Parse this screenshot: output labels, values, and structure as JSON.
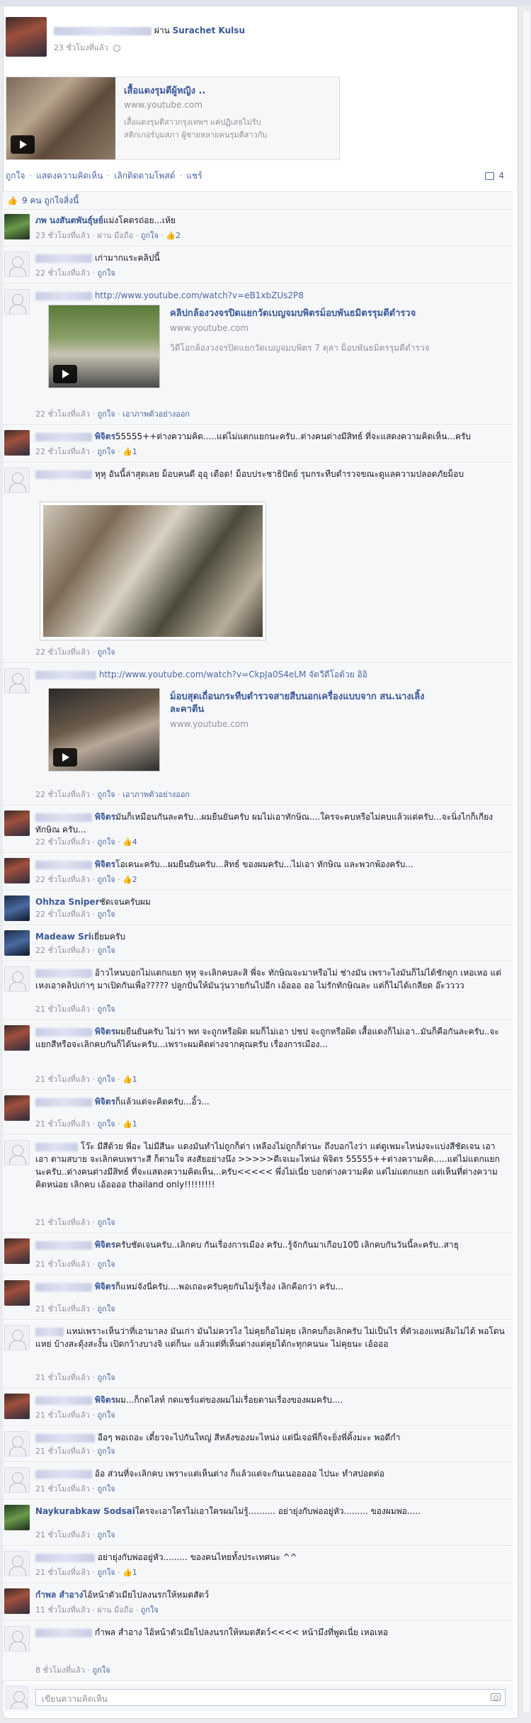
{
  "post": {
    "via": "ผ่าน",
    "via_name": "Surachet Kulsu",
    "time": "23 ชั่วโมงที่แล้ว",
    "share_title": "เสื้อแดงรุมตีผู้หญิง ..",
    "share_site": "www.youtube.com",
    "share_desc_1": "เสื้อแดงรุมตีสาวกรุงเทพฯ แค่ปฏิเสธไม่รับ",
    "share_desc_2": "สติกเกอร์บุมสภา ผู้ชายหลายคนรุมตีสาวกับ"
  },
  "actions": {
    "like": "ถูกใจ",
    "comment": "แสดงความคิดเห็น",
    "unfollow": "เลิกติดตามโพสต์",
    "share": "แชร์",
    "comment_count": "4"
  },
  "likes_summary": "9 คน ถูกใจสิ่งนี้",
  "common": {
    "like": "ถูกใจ",
    "remove_preview": "เอาภาพตัวอย่างออก",
    "dot": " · "
  },
  "comments": [
    {
      "name": "ภพ นงสันตพันธุ์ษย์",
      "text": "แม่งโคตรถ่อย...เห้ย",
      "time": "23 ชั่วโมงที่แล้ว",
      "extra": "ผ่าน มือถือ",
      "likes": "2"
    },
    {
      "name": "",
      "text": "เก่ามากแระคลิปนี้",
      "time": "22 ชั่วโมงที่แล้ว",
      "extra": "",
      "likes": ""
    },
    {
      "name": "",
      "text": "http://www.youtube.com/watch?v=eB1xbZUs2P8",
      "time": "22 ชั่วโมงที่แล้ว",
      "extra": "",
      "likes": "",
      "embed_title": "คลิปกล้องวงจรปิดแยกวัดเบญจมบพิตรม็อบพันธมิตรรุมตีตำรวจ",
      "embed_site": "www.youtube.com",
      "embed_desc": "วิดีโอกล้องวงจรปิดแยกวัดเบญจมบพิตร 7 ตุลา ม็อบพันธมิตรรุมตีตำรวจ"
    },
    {
      "name": "พิจิตร",
      "text": "55555++ต่างความคิด.....แต่ไม่แตกแยกนะครับ..ต่างคนต่างมีสิทธ์ ที่จะแสดงความคิดเห็น...ครับ",
      "time": "22 ชั่วโมงที่แล้ว",
      "extra": "",
      "likes": "1"
    },
    {
      "name": "",
      "text": "หุหุ อันนี้ล่าสุดเลย ม็อบคนดี อุอุ เดือด! ม็อบประชาธิปัตย์ รุมกระทืบตำรวจขณะดูแลความปลอดภัยม็อบ",
      "time": "22 ชั่วโมงที่แล้ว",
      "extra": "",
      "likes": ""
    },
    {
      "name": "",
      "text": "http://www.youtube.com/watch?v=CkpJa0S4eLM จัดวีดีโอด้วย อิอิ",
      "time": "22 ชั่วโมงที่แล้ว",
      "extra": "",
      "likes": "",
      "embed_title": "ม็อบสุดเถื่อนกระทืบตำรวจสายสืบนอกเครื่องแบบจาก สน.นางเลิ้ง",
      "embed_title_2": "ละคาตีน",
      "embed_site": "www.youtube.com"
    },
    {
      "name": "พิจิตร",
      "text": "มันก็เหมือนกันละครับ...ผมยืนยันครับ ผมไม่เอาทักษิณ....ใครจะคบหรือไม่คบแล้วแต่ครับ...จะนิ่งไกก็เกียงทักษิณ ครับ...",
      "time": "22 ชั่วโมงที่แล้ว",
      "extra": "",
      "likes": "4"
    },
    {
      "name": "พิจิตร",
      "text": "โอเคนะครับ...ผมยืนยันครับ...สิทธ์ ของผมครับ...ไม่เอา ทักษิณ และพวกพ้องครับ...",
      "time": "22 ชั่วโมงที่แล้ว",
      "extra": "",
      "likes": "2"
    },
    {
      "name": "Ohhza Sniper",
      "text": "ชัดเจนครับผม",
      "time": "22 ชั่วโมงที่แล้ว",
      "extra": "",
      "likes": ""
    },
    {
      "name": "Madeaw Sri",
      "text": "เยี่ยมครับ",
      "time": "22 ชั่วโมงที่แล้ว",
      "extra": "",
      "likes": ""
    },
    {
      "name": "",
      "text": "อ้าวไหนบอกไม่แตกแยก หุหุ จะเลิกคบละสิ พี่จะ ทักษิณจะมาหรือไม่ ช่างมัน เพราะไงมันก็ไม่ได้ชักดูก เหอเหอ แต่เหงเอาคลิปเก่าๆ มาเปิดกันเพื่อ????? ปลูกปั่นให้มันวุ่นวายกันไปอีก เอ้อออ ออ ไม่รักทักษิณละ แต่ก็ไม่ได้เกลียด อ๊ะวววว",
      "time": "21 ชั่วโมงที่แล้ว",
      "extra": "",
      "likes": ""
    },
    {
      "name": "พิจิตร",
      "text": "ผมยืนยันครับ ไม่ว่า พท จะถูกหรือผิด ผมก็ไม่เอา ปชป จะถูกหรือผิด เสื้อแดงก็ไม่เอา..มันก็คือกันละครับ..จะแยกสีหรือจะเลิกคบกันก็ได้นะครับ...เพราะผมคิดต่างจากคุณครับ เรื่องการเมือง...",
      "time": "21 ชั่วโมงที่แล้ว",
      "extra": "",
      "likes": "1"
    },
    {
      "name": "พิจิตร",
      "text": "ก็แล้วแต่จะคิดครับ...อิ้ว...",
      "time": "21 ชั่วโมงที่แล้ว",
      "extra": "",
      "likes": "1"
    },
    {
      "name": "",
      "text": "โว๊ะ มีสีด้วย พี่อะ ไม่มีสีนะ แดงมันทำไม่ถูกก็ด่า เหลืองไม่ถูกก็ด่านะ ถึงบอกไงว่า แต่ดูเพมะไหน่งจะแบ่งสีชัดเจน เอาเอา ตามสบาย จะเลิกคบเพราะสี ก็ตามใจ สงสัยอย่างนึง >>>>>ดีเจเมะไหน่ง พิจิตร 55555++ต่างความคิด.....แต่ไม่แตกแยกนะครับ..ต่างคนต่างมีสิทธ์ ที่จะแสดงความคิดเห็น...ครับ<<<<< พึ่งไม่เนี่ย บอกต่างความคิด แต่ไม่แตกแยก แต่เห็นที่ต่างความคิดหน่อย เลิกคบ เอ้ออออ thailand only!!!!!!!!!",
      "time": "21 ชั่วโมงที่แล้ว",
      "extra": "",
      "likes": ""
    },
    {
      "name": "พิจิตร",
      "text": "ครับชัดเจนครับ..เลิกคบ กันเรื่องการเมือง ครับ..รู้จักกันมาเกือบ10ปี เลิกคบกันวันนี้ละครับ..สาธุ",
      "time": "21 ชั่วโมงที่แล้ว",
      "extra": "",
      "likes": ""
    },
    {
      "name": "พิจิตร",
      "text": "ก็แหม่จังนี่ครับ....พอเถอะครับคุยกันไม่รู้เรื่อง เลิกคือกว่า ครับ...",
      "time": "21 ชั่วโมงที่แล้ว",
      "extra": "",
      "likes": ""
    },
    {
      "name": "",
      "text": "แหม่เพราะเห็นว่าที่เอามาลง มันเก่า มันไม่ควรไง ไม่คุยก็อไม่คุย เลิกคบก็อเลิกครับ ไม่เป็นไร ที่ตัวเองแหม่ลืมไม่ได้ พอโดนแหย่ บ้างสะดุ้งสะงั้น เปิดกว้างบางจิ แต่ก็นะ แล้วแต่ที่เห็นต่างแต่คุยได้กะทุกคนนะ ไม่คุยนะ เอ้อออ",
      "time": "21 ชั่วโมงที่แล้ว",
      "extra": "",
      "likes": ""
    },
    {
      "name": "พิจิตร",
      "text": "ผม...ก็กดไลท์ กดแชร์แต่ของผมไม่เรื่อยตามเรื่องของผมครับ....",
      "time": "21 ชั่วโมงที่แล้ว",
      "extra": "",
      "likes": ""
    },
    {
      "name": "",
      "text": "อือๆ พอเถอะ เดี๋ยวจะไปกันใหญ่ สีหลังของมะไหน่ง แต่นี่เจอพี่ก็จะยิ่งพี่คิ้งมะะ พอดีกำ",
      "time": "21 ชั่วโมงที่แล้ว",
      "extra": "",
      "likes": ""
    },
    {
      "name": "",
      "text": "อ้อ ส่วนที่จะเลิกคบ เพราะแต่เห็นต่าง ก็แล้วแต่จะกันเนอออออ ไปนะ ทำสปอตต่อ",
      "time": "21 ชั่วโมงที่แล้ว",
      "extra": "",
      "likes": ""
    },
    {
      "name": "Naykurabkaw Sodsai",
      "text": "ใครจะเอาใครไม่เอาใครผมไม่รู้.......... อย่ายุ่งกับพ่ออยู่หัว......... ของผมพอ.....",
      "time": "21 ชั่วโมงที่แล้ว",
      "extra": "",
      "likes": ""
    },
    {
      "name": "",
      "text": "อย่ายุ่งกับพ่ออยู่หัว......... ของคนไทยทั้งประเทศนะ ^^",
      "time": "21 ชั่วโมงที่แล้ว",
      "extra": "",
      "likes": "1"
    },
    {
      "name": "กำพล สำอาง",
      "text": "ไอ้หน้าตัวเมียไปลงนรกให้หมดสัตว์",
      "time": "11 ชั่วโมงที่แล้ว",
      "extra": "ผ่าน มือถือ",
      "likes": ""
    },
    {
      "name": "",
      "text": "กำพล สำอาง ไอ้หน้าตัวเมียไปลงนรกให้หมดสัตว์<<<< หน้ามึงที่พูดเนี่ย เหอเหอ",
      "time": "8 ชั่วโมงที่แล้ว",
      "extra": "",
      "likes": ""
    }
  ],
  "compose_placeholder": "เขียนความคิดเห็น"
}
